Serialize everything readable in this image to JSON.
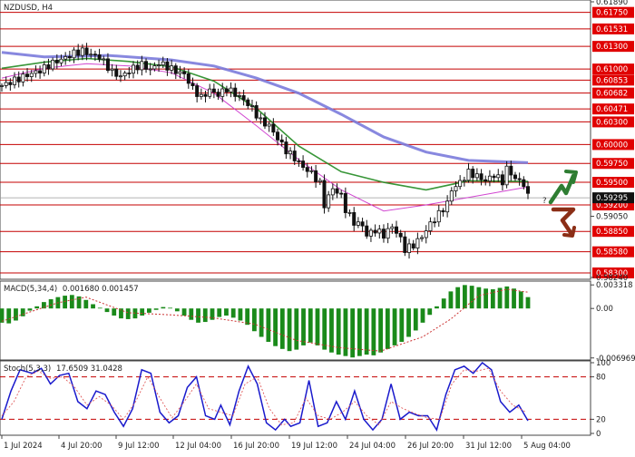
{
  "chart_data": [
    {
      "type": "line",
      "title": "NZDUSD, H4",
      "symbol": "NZDUSD",
      "timeframe": "H4",
      "ylim": [
        0.5824,
        0.6189
      ],
      "x_tick_labels": [
        "1 Jul 2024",
        "4 Jul 20:00",
        "9 Jul 12:00",
        "12 Jul 04:00",
        "16 Jul 20:00",
        "19 Jul 12:00",
        "24 Jul 04:00",
        "26 Jul 20:00",
        "31 Jul 12:00",
        "5 Aug 04:00"
      ],
      "y_tick_labels": [
        "0.61890",
        "0.61750",
        "0.61531",
        "0.61300",
        "0.61000",
        "0.60853",
        "0.60682",
        "0.60471",
        "0.60300",
        "0.60000",
        "0.59750",
        "0.59500",
        "0.59295",
        "0.59200",
        "0.59050",
        "0.58850",
        "0.58580",
        "0.58300",
        "0.58240"
      ],
      "current_price": "0.59295",
      "level_lines": [
        {
          "label": "0.61750",
          "value": 0.6175
        },
        {
          "label": "0.61531",
          "value": 0.61531
        },
        {
          "label": "0.61300",
          "value": 0.613
        },
        {
          "label": "0.61000",
          "value": 0.61
        },
        {
          "label": "0.60853",
          "value": 0.60853
        },
        {
          "label": "0.60682",
          "value": 0.60682
        },
        {
          "label": "0.60471",
          "value": 0.60471
        },
        {
          "label": "0.60300",
          "value": 0.603
        },
        {
          "label": "0.60000",
          "value": 0.6
        },
        {
          "label": "0.59750",
          "value": 0.5975
        },
        {
          "label": "0.59500",
          "value": 0.595
        },
        {
          "label": "0.59200",
          "value": 0.592
        },
        {
          "label": "0.58850",
          "value": 0.5885
        },
        {
          "label": "0.58580",
          "value": 0.5858
        },
        {
          "label": "0.58300",
          "value": 0.583
        }
      ],
      "close_points": [
        [
          0,
          0.6078
        ],
        [
          3,
          0.6085
        ],
        [
          6,
          0.6092
        ],
        [
          9,
          0.6098
        ],
        [
          12,
          0.6108
        ],
        [
          15,
          0.6115
        ],
        [
          17,
          0.6121
        ],
        [
          19,
          0.6124
        ],
        [
          21,
          0.6119
        ],
        [
          23,
          0.6116
        ],
        [
          26,
          0.6096
        ],
        [
          28,
          0.609
        ],
        [
          31,
          0.6101
        ],
        [
          33,
          0.6106
        ],
        [
          35,
          0.6099
        ],
        [
          37,
          0.6108
        ],
        [
          39,
          0.6103
        ],
        [
          41,
          0.6097
        ],
        [
          43,
          0.6093
        ],
        [
          45,
          0.6074
        ],
        [
          47,
          0.6062
        ],
        [
          49,
          0.6072
        ],
        [
          51,
          0.6066
        ],
        [
          53,
          0.6074
        ],
        [
          55,
          0.6067
        ],
        [
          57,
          0.6059
        ],
        [
          59,
          0.6048
        ],
        [
          61,
          0.6031
        ],
        [
          63,
          0.6025
        ],
        [
          65,
          0.6008
        ],
        [
          67,
          0.5992
        ],
        [
          69,
          0.5982
        ],
        [
          71,
          0.597
        ],
        [
          73,
          0.5962
        ],
        [
          75,
          0.5948
        ],
        [
          76,
          0.592
        ],
        [
          78,
          0.5942
        ],
        [
          80,
          0.5932
        ],
        [
          81,
          0.5914
        ],
        [
          83,
          0.5897
        ],
        [
          85,
          0.5893
        ],
        [
          86,
          0.588
        ],
        [
          88,
          0.5887
        ],
        [
          90,
          0.588
        ],
        [
          92,
          0.5892
        ],
        [
          94,
          0.5875
        ],
        [
          95,
          0.5861
        ],
        [
          97,
          0.5867
        ],
        [
          99,
          0.5878
        ],
        [
          101,
          0.5895
        ],
        [
          103,
          0.5908
        ],
        [
          105,
          0.5922
        ],
        [
          106,
          0.594
        ],
        [
          108,
          0.595
        ],
        [
          110,
          0.5963
        ],
        [
          112,
          0.5958
        ],
        [
          114,
          0.5952
        ],
        [
          116,
          0.596
        ],
        [
          118,
          0.5951
        ],
        [
          119,
          0.5968
        ],
        [
          121,
          0.5955
        ],
        [
          123,
          0.5948
        ],
        [
          124,
          0.5931
        ]
      ],
      "series": [
        {
          "name": "",
          "color": "#7b7bdc",
          "values": [
            [
              0,
              0.6122
            ],
            [
              10,
              0.6116
            ],
            [
              25,
              0.6118
            ],
            [
              40,
              0.6112
            ],
            [
              50,
              0.6104
            ],
            [
              60,
              0.6088
            ],
            [
              70,
              0.6068
            ],
            [
              80,
              0.604
            ],
            [
              90,
              0.601
            ],
            [
              100,
              0.599
            ],
            [
              110,
              0.5979
            ],
            [
              124,
              0.5976
            ]
          ]
        },
        {
          "name": "",
          "color": "#228b22",
          "values": [
            [
              0,
              0.6101
            ],
            [
              10,
              0.6109
            ],
            [
              20,
              0.6114
            ],
            [
              30,
              0.611
            ],
            [
              40,
              0.6103
            ],
            [
              50,
              0.6084
            ],
            [
              60,
              0.6048
            ],
            [
              70,
              0.5998
            ],
            [
              80,
              0.5964
            ],
            [
              90,
              0.595
            ],
            [
              100,
              0.594
            ],
            [
              110,
              0.5952
            ],
            [
              124,
              0.5951
            ]
          ]
        },
        {
          "name": "",
          "color": "#cc33cc",
          "values": [
            [
              0,
              0.6088
            ],
            [
              10,
              0.6101
            ],
            [
              20,
              0.6107
            ],
            [
              30,
              0.6104
            ],
            [
              40,
              0.6095
            ],
            [
              50,
              0.6068
            ],
            [
              60,
              0.6025
            ],
            [
              70,
              0.598
            ],
            [
              80,
              0.594
            ],
            [
              90,
              0.5912
            ],
            [
              100,
              0.592
            ],
            [
              110,
              0.593
            ],
            [
              124,
              0.5944
            ]
          ]
        }
      ],
      "forecast_arrows": [
        {
          "direction": "up",
          "color": "#2e7d32"
        },
        {
          "direction": "down",
          "color": "#8b2e16"
        }
      ],
      "forecast_mark": "?"
    },
    {
      "type": "bar",
      "title": "MACD(5,34,4)",
      "header_values": "0.001680 0.001457",
      "ylim": [
        -0.007,
        0.0036
      ],
      "y_tick_labels": [
        "0.003318",
        "0.00",
        "-0.006969"
      ],
      "bar_color": "#1a8a1a",
      "signal_color": "#cc3333",
      "values": [
        -0.002,
        -0.0021,
        -0.0017,
        -0.0011,
        -0.0003,
        0.0003,
        0.0009,
        0.0013,
        0.0016,
        0.0018,
        0.0019,
        0.0017,
        0.0012,
        0.0006,
        0.0001,
        -0.0005,
        -0.001,
        -0.0014,
        -0.0015,
        -0.0014,
        -0.001,
        -0.0006,
        -0.0002,
        0.0002,
        0.0001,
        -0.0004,
        -0.001,
        -0.0016,
        -0.002,
        -0.0019,
        -0.0016,
        -0.0012,
        -0.001,
        -0.0013,
        -0.0017,
        -0.0023,
        -0.0032,
        -0.004,
        -0.0047,
        -0.0053,
        -0.0057,
        -0.006,
        -0.0058,
        -0.0052,
        -0.0048,
        -0.0052,
        -0.0058,
        -0.0062,
        -0.0065,
        -0.0067,
        -0.0069,
        -0.0067,
        -0.0065,
        -0.0066,
        -0.0062,
        -0.0057,
        -0.0052,
        -0.0047,
        -0.004,
        -0.0031,
        -0.002,
        -0.0009,
        0.0003,
        0.0014,
        0.0024,
        0.003,
        0.0033,
        0.0032,
        0.003,
        0.0028,
        0.0027,
        0.0029,
        0.0031,
        0.0028,
        0.0024,
        0.0016
      ],
      "signal": [
        [
          0,
          -0.0018
        ],
        [
          8,
          0.0008
        ],
        [
          12,
          0.0016
        ],
        [
          18,
          -0.0006
        ],
        [
          24,
          -0.0009
        ],
        [
          30,
          -0.0013
        ],
        [
          36,
          -0.0022
        ],
        [
          42,
          -0.0045
        ],
        [
          48,
          -0.0055
        ],
        [
          54,
          -0.006
        ],
        [
          60,
          -0.004
        ],
        [
          64,
          -0.0015
        ],
        [
          68,
          0.0018
        ],
        [
          72,
          0.0027
        ],
        [
          75,
          0.0023
        ]
      ]
    },
    {
      "type": "line",
      "title": "Stoch(5,3,3)",
      "header_values": "17.6509 31.0428",
      "ylim": [
        0,
        100
      ],
      "y_tick_labels": [
        "100",
        "80",
        "20",
        "0"
      ],
      "levels": [
        80,
        20
      ],
      "series": [
        {
          "name": "",
          "color": "#1a1acc",
          "values": [
            [
              0,
              20
            ],
            [
              3,
              60
            ],
            [
              6,
              90
            ],
            [
              10,
              85
            ],
            [
              13,
              92
            ],
            [
              16,
              70
            ],
            [
              19,
              82
            ],
            [
              22,
              85
            ],
            [
              25,
              45
            ],
            [
              28,
              35
            ],
            [
              31,
              60
            ],
            [
              34,
              55
            ],
            [
              37,
              30
            ],
            [
              40,
              10
            ],
            [
              43,
              35
            ],
            [
              46,
              90
            ],
            [
              49,
              85
            ],
            [
              52,
              30
            ],
            [
              55,
              15
            ],
            [
              58,
              25
            ],
            [
              61,
              65
            ],
            [
              64,
              80
            ],
            [
              67,
              25
            ],
            [
              70,
              20
            ],
            [
              72,
              40
            ],
            [
              75,
              12
            ],
            [
              78,
              60
            ],
            [
              81,
              95
            ],
            [
              84,
              70
            ],
            [
              87,
              15
            ],
            [
              90,
              5
            ],
            [
              93,
              20
            ],
            [
              95,
              10
            ],
            [
              98,
              15
            ],
            [
              101,
              75
            ],
            [
              104,
              10
            ],
            [
              107,
              15
            ],
            [
              110,
              45
            ],
            [
              113,
              20
            ],
            [
              116,
              60
            ],
            [
              119,
              20
            ],
            [
              122,
              5
            ],
            [
              125,
              20
            ],
            [
              128,
              70
            ],
            [
              131,
              20
            ],
            [
              134,
              30
            ],
            [
              137,
              25
            ],
            [
              140,
              25
            ],
            [
              143,
              5
            ],
            [
              146,
              55
            ],
            [
              149,
              90
            ],
            [
              152,
              95
            ],
            [
              155,
              85
            ],
            [
              158,
              100
            ],
            [
              161,
              90
            ],
            [
              164,
              45
            ],
            [
              167,
              30
            ],
            [
              170,
              40
            ],
            [
              173,
              18
            ]
          ]
        },
        {
          "name": "",
          "color": "#e05a5a",
          "values": [
            [
              0,
              25
            ],
            [
              4,
              45
            ],
            [
              8,
              80
            ],
            [
              12,
              88
            ],
            [
              16,
              78
            ],
            [
              20,
              80
            ],
            [
              24,
              65
            ],
            [
              28,
              40
            ],
            [
              32,
              52
            ],
            [
              36,
              40
            ],
            [
              40,
              20
            ],
            [
              44,
              45
            ],
            [
              48,
              80
            ],
            [
              52,
              50
            ],
            [
              56,
              22
            ],
            [
              60,
              45
            ],
            [
              64,
              70
            ],
            [
              68,
              35
            ],
            [
              72,
              30
            ],
            [
              76,
              25
            ],
            [
              80,
              70
            ],
            [
              84,
              80
            ],
            [
              88,
              35
            ],
            [
              92,
              12
            ],
            [
              96,
              15
            ],
            [
              100,
              50
            ],
            [
              104,
              25
            ],
            [
              108,
              20
            ],
            [
              112,
              30
            ],
            [
              116,
              45
            ],
            [
              120,
              25
            ],
            [
              124,
              12
            ],
            [
              128,
              45
            ],
            [
              132,
              35
            ],
            [
              136,
              28
            ],
            [
              140,
              22
            ],
            [
              144,
              20
            ],
            [
              148,
              70
            ],
            [
              152,
              90
            ],
            [
              156,
              88
            ],
            [
              160,
              92
            ],
            [
              164,
              60
            ],
            [
              168,
              40
            ],
            [
              172,
              31
            ]
          ]
        }
      ]
    }
  ]
}
